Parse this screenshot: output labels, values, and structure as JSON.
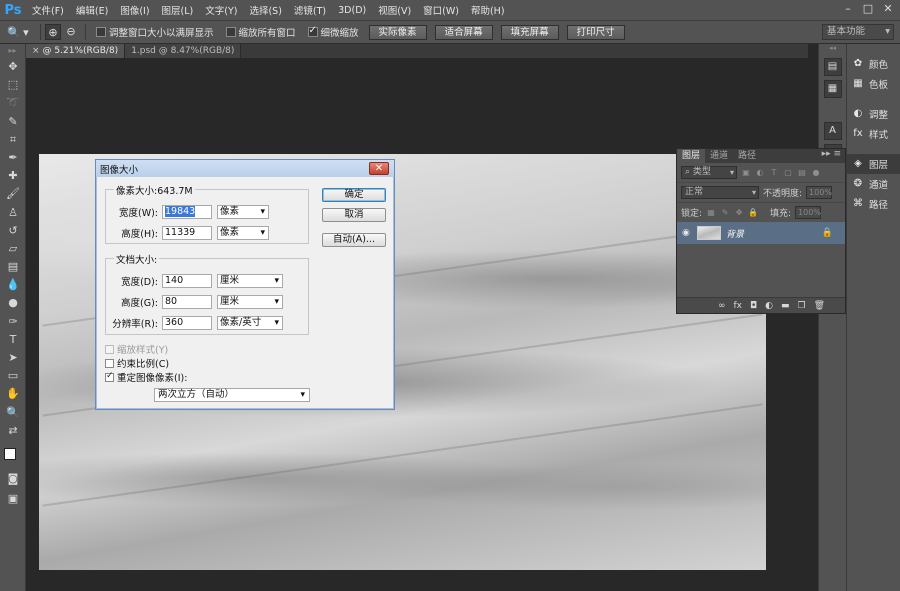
{
  "app": {
    "logo": "Ps"
  },
  "menu": [
    "文件(F)",
    "编辑(E)",
    "图像(I)",
    "图层(L)",
    "文字(Y)",
    "选择(S)",
    "滤镜(T)",
    "3D(D)",
    "视图(V)",
    "窗口(W)",
    "帮助(H)"
  ],
  "window_controls": {
    "minimize": "–",
    "maximize": "□",
    "close": "✕"
  },
  "options": {
    "resize_windows_label": "调整窗口大小以满屏显示",
    "resize_windows_checked": false,
    "zoom_all_label": "缩放所有窗口",
    "zoom_all_checked": false,
    "scrubby_zoom_label": "细微缩放",
    "scrubby_zoom_checked": true,
    "actual_pixels": "实际像素",
    "fit_screen": "适合屏幕",
    "fill_screen": "填充屏幕",
    "print_size": "打印尺寸",
    "workspace": "基本功能"
  },
  "tabs": [
    {
      "label": "@ 5.21%(RGB/8)",
      "active": true
    },
    {
      "label": "1.psd @ 8.47%(RGB/8)",
      "active": false
    }
  ],
  "dock": {
    "color": "颜色",
    "swatches": "色板",
    "adjustments": "调整",
    "styles": "样式",
    "layers": "图层",
    "channels": "通道",
    "paths": "路径"
  },
  "layers_panel": {
    "tabs": [
      "图层",
      "通道",
      "路径"
    ],
    "filter_kind": "类型",
    "blend_mode": "正常",
    "opacity_label": "不透明度:",
    "opacity_value": "100%",
    "lock_label": "锁定:",
    "fill_label": "填充:",
    "fill_value": "100%",
    "layer_name": "背景"
  },
  "dialog": {
    "title": "图像大小",
    "pixel_dimensions": "像素大小:643.7M",
    "width_label": "宽度(W):",
    "width_value": "19843",
    "width_unit": "像素",
    "height_label": "高度(H):",
    "height_value": "11339",
    "height_unit": "像素",
    "document_size": "文档大小:",
    "doc_width_label": "宽度(D):",
    "doc_width_value": "140",
    "doc_width_unit": "厘米",
    "doc_height_label": "高度(G):",
    "doc_height_value": "80",
    "doc_height_unit": "厘米",
    "resolution_label": "分辨率(R):",
    "resolution_value": "360",
    "resolution_unit": "像素/英寸",
    "ok": "确定",
    "cancel": "取消",
    "auto": "自动(A)...",
    "scale_styles": "缩放样式(Y)",
    "scale_styles_checked": false,
    "constrain": "约束比例(C)",
    "constrain_checked": false,
    "resample": "重定图像像素(I):",
    "resample_checked": true,
    "resample_method": "两次立方（自动）"
  }
}
